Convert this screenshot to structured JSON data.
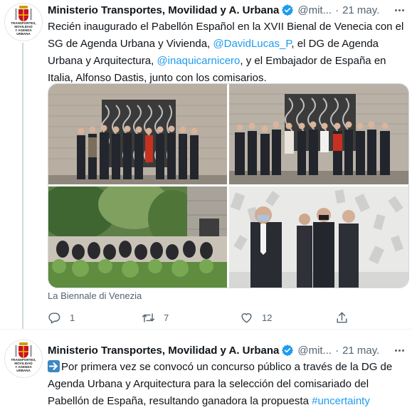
{
  "tweets": [
    {
      "avatar_text": "TRANSPORTES,\nMOVILIDAD\nY AGENDA\nURBANA",
      "author_name": "Ministerio Transportes, Movilidad y A. Urbana",
      "handle": "@mit...",
      "date": "21 may.",
      "text_parts": [
        "Recién inaugurado el Pabellón Español en la XVII Bienal de Venecia con el SG de Agenda Urbana y Vivienda, ",
        "@DavidLucas_P",
        ", el DG de Agenda Urbana y Arquitectura, ",
        "@inaquicarnicero",
        ", y el Embajador de España en Italia, Alfonso Dastis, junto con los comisarios."
      ],
      "media_caption": "La Biennale di Venezia",
      "counts": {
        "replies": "1",
        "retweets": "7",
        "likes": "12"
      }
    },
    {
      "avatar_text": "TRANSPORTES,\nMOVILIDAD\nY AGENDA\nURBANA",
      "author_name": "Ministerio Transportes, Movilidad y A. Urbana",
      "handle": "@mit...",
      "date": "21 may.",
      "text_parts": [
        "Por primera vez se convocó un concurso público a través de la DG de Agenda Urbana y Arquitectura para la selección del comisariado del Pabellón de España, resultando ganadora la propuesta ",
        "#uncertainty"
      ]
    }
  ],
  "separator": "·",
  "icons": [
    "verified-badge-icon",
    "more-icon",
    "reply-icon",
    "retweet-icon",
    "like-icon",
    "share-icon",
    "arrow-right-emoji-icon",
    "coat-of-arms-icon"
  ],
  "colors": {
    "link": "#1d9bf0",
    "secondary_text": "#536471",
    "verified": "#1d9bf0",
    "emoji_arrow_bg": "#3b88c3"
  }
}
